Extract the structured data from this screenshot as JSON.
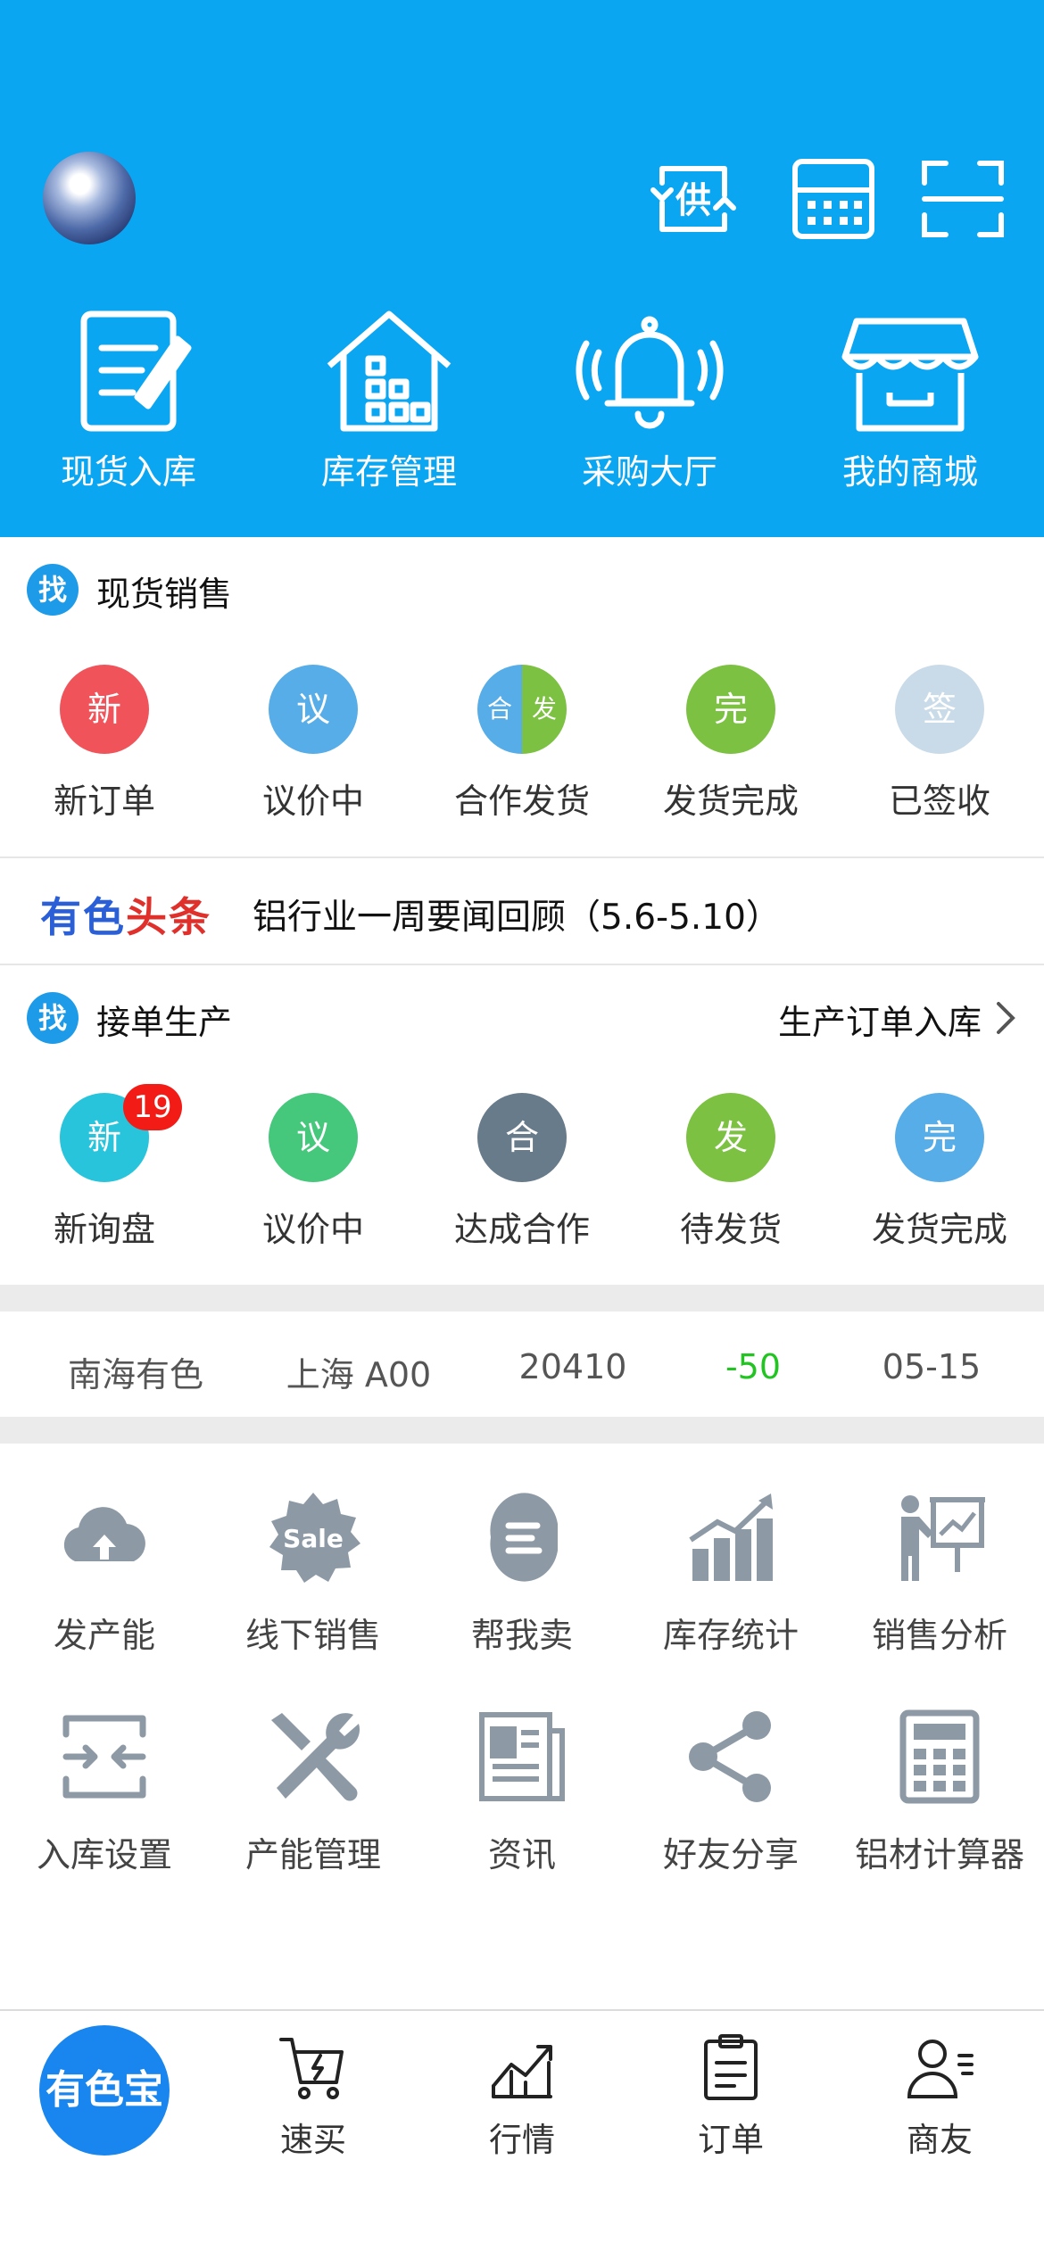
{
  "colors": {
    "header_bg": "#0aa6f2",
    "accent_blue": "#1e9be8",
    "price_change_green": "#22c422",
    "badge_red": "#f31b16"
  },
  "header": {
    "avatar": "avatar",
    "icons": [
      {
        "name": "supply-exchange-icon",
        "text": "供"
      },
      {
        "name": "calculator-icon"
      },
      {
        "name": "scan-icon"
      }
    ],
    "quick_actions": [
      {
        "label": "现货入库",
        "icon": "notepad-edit-icon"
      },
      {
        "label": "库存管理",
        "icon": "warehouse-icon"
      },
      {
        "label": "采购大厅",
        "icon": "bell-icon"
      },
      {
        "label": "我的商城",
        "icon": "storefront-icon"
      }
    ]
  },
  "spot_sales": {
    "badge": "找",
    "title": "现货销售",
    "statuses": [
      {
        "label": "新订单",
        "glyph": "新",
        "color": "#f0545a"
      },
      {
        "label": "议价中",
        "glyph": "议",
        "color": "#57ade8"
      },
      {
        "label": "合作发货",
        "glyph_left": "合",
        "glyph_right": "发",
        "color_left": "#57ade8",
        "color_right": "#7cc142"
      },
      {
        "label": "发货完成",
        "glyph": "完",
        "color": "#7cc142"
      },
      {
        "label": "已签收",
        "glyph": "签",
        "color": "#c9dbe8"
      }
    ]
  },
  "headline": {
    "logo_part1": "有色",
    "logo_part2": "头条",
    "text": "铝行业一周要闻回顾（5.6-5.10）"
  },
  "production": {
    "badge": "找",
    "title": "接单生产",
    "link": "生产订单入库",
    "statuses": [
      {
        "label": "新询盘",
        "glyph": "新",
        "color": "#28c4dc",
        "count": "19"
      },
      {
        "label": "议价中",
        "glyph": "议",
        "color": "#45c77c"
      },
      {
        "label": "达成合作",
        "glyph": "合",
        "color": "#687b8b"
      },
      {
        "label": "待发货",
        "glyph": "发",
        "color": "#7cc142"
      },
      {
        "label": "发货完成",
        "glyph": "完",
        "color": "#57ade8"
      }
    ]
  },
  "ticker": {
    "market": "南海有色",
    "product": "上海 A00",
    "price": "20410",
    "change": "-50",
    "date": "05-15"
  },
  "tools": [
    {
      "label": "发产能",
      "icon": "cloud-upload-icon"
    },
    {
      "label": "线下销售",
      "icon": "sale-badge-icon",
      "icon_text": "Sale"
    },
    {
      "label": "帮我卖",
      "icon": "help-sell-icon"
    },
    {
      "label": "库存统计",
      "icon": "bar-chart-icon"
    },
    {
      "label": "销售分析",
      "icon": "presentation-icon"
    },
    {
      "label": "入库设置",
      "icon": "inbound-settings-icon"
    },
    {
      "label": "产能管理",
      "icon": "tools-icon"
    },
    {
      "label": "资讯",
      "icon": "newspaper-icon"
    },
    {
      "label": "好友分享",
      "icon": "share-icon"
    },
    {
      "label": "铝材计算器",
      "icon": "calculator-icon"
    }
  ],
  "tabbar": {
    "home": "有色宝",
    "tabs": [
      {
        "label": "速买",
        "icon": "cart-icon"
      },
      {
        "label": "行情",
        "icon": "trend-chart-icon"
      },
      {
        "label": "订单",
        "icon": "clipboard-icon"
      },
      {
        "label": "商友",
        "icon": "contacts-icon"
      }
    ]
  }
}
